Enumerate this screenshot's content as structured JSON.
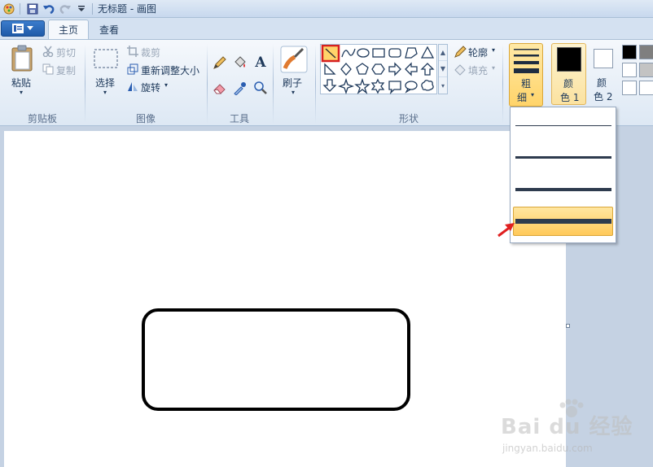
{
  "window": {
    "title": "无标题 - 画图"
  },
  "quick_access": {
    "icons": [
      "paint-app-icon",
      "save-icon",
      "undo-icon",
      "redo-icon",
      "customize-dropdown-icon"
    ]
  },
  "tabs": [
    {
      "label": "主页",
      "active": true
    },
    {
      "label": "查看",
      "active": false
    }
  ],
  "ribbon": {
    "clipboard": {
      "paste": "粘贴",
      "cut": "剪切",
      "copy": "复制",
      "group": "剪贴板"
    },
    "image": {
      "select": "选择",
      "crop": "裁剪",
      "resize": "重新调整大小",
      "rotate": "旋转",
      "group": "图像"
    },
    "tools": {
      "group": "工具",
      "text_tool": "A"
    },
    "brushes": {
      "label": "刷子"
    },
    "shapes": {
      "outline": "轮廓",
      "fill": "填充",
      "group": "形状"
    },
    "size": {
      "label_line1": "粗",
      "label_line2": "细"
    },
    "color1": {
      "label_line1": "颜",
      "label_line2": "色 1",
      "value": "#000000"
    },
    "color2": {
      "label_line1": "颜",
      "label_line2": "色 2",
      "value": "#ffffff"
    },
    "palette": [
      "#000000",
      "#7f7f7f",
      "#ffffff",
      "#c3c3c3",
      "#ffffff",
      "#ffffff"
    ]
  },
  "size_dropdown": {
    "options": [
      {
        "weight": 1,
        "selected": false
      },
      {
        "weight": 3,
        "selected": false
      },
      {
        "weight": 5,
        "selected": false
      },
      {
        "weight": 8,
        "selected": true
      }
    ]
  },
  "accent": {
    "selected_fill": "#ffd46a",
    "selection_border": "#d62020",
    "arrow": "#e02020"
  },
  "watermark": {
    "main": "Bai du 经验",
    "sub": "jingyan.baidu.com"
  }
}
